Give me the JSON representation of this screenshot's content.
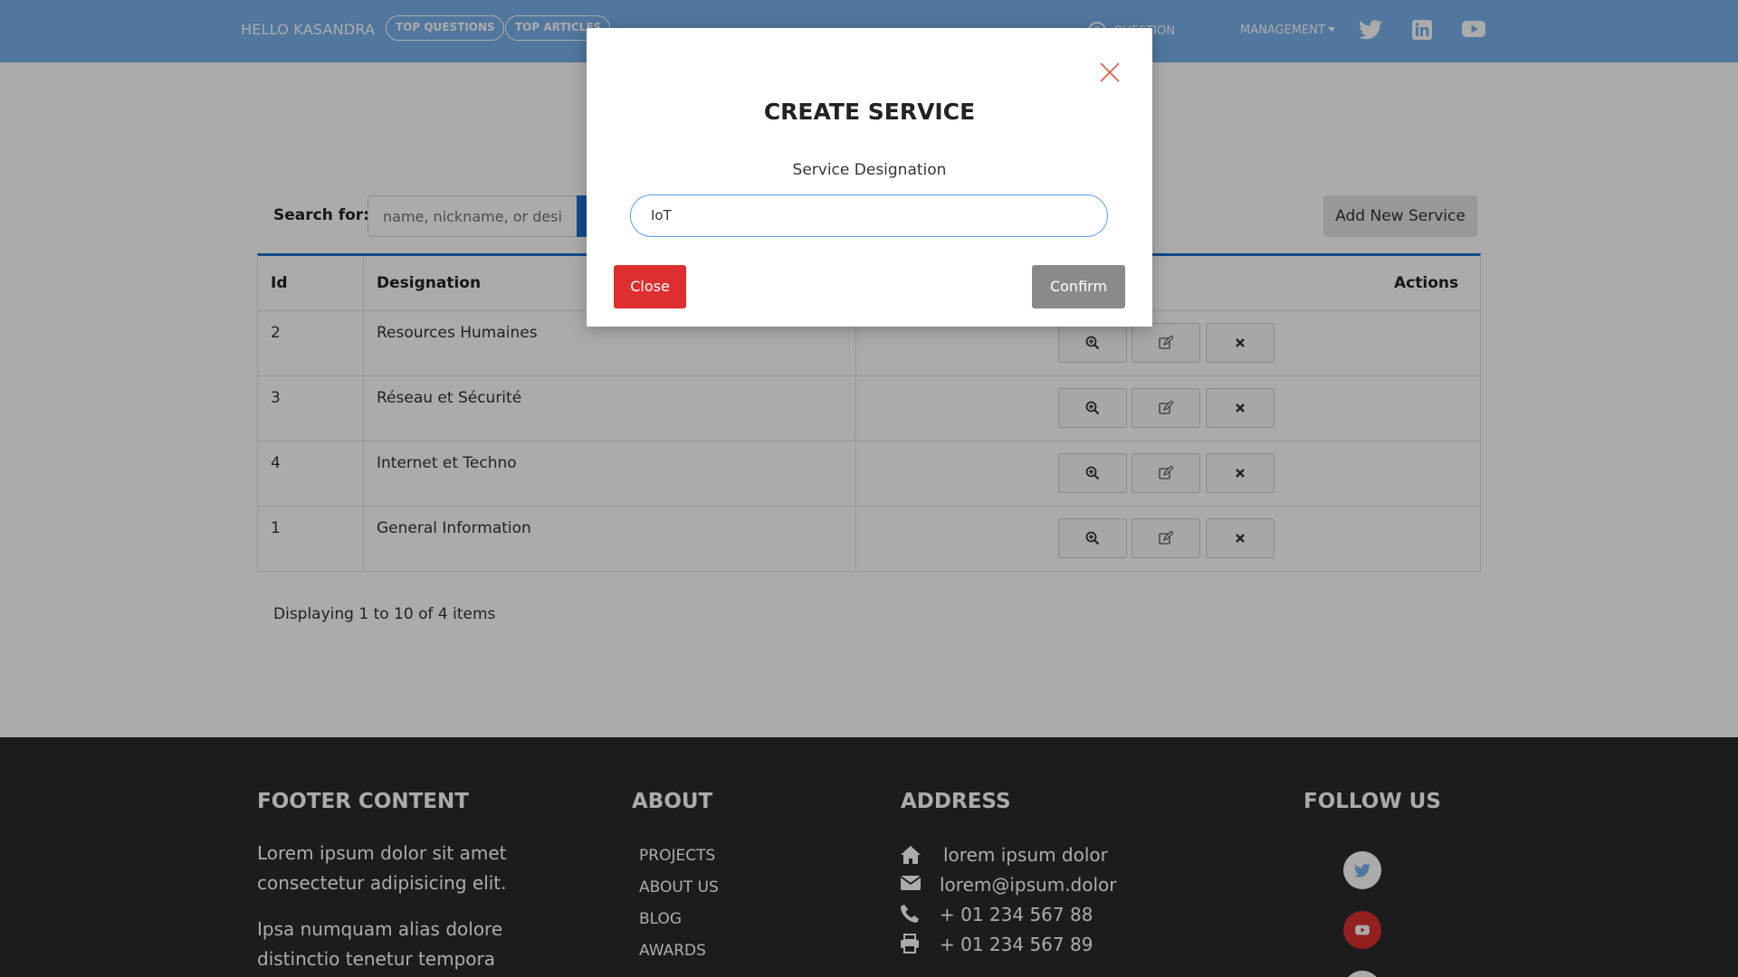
{
  "navbar": {
    "greeting": "HELLO KASANDRA",
    "pills": [
      "TOP QUESTIONS",
      "TOP ARTICLES"
    ],
    "ask_question": "QUESTION",
    "management": "MANAGEMENT",
    "social_icons": [
      "twitter-icon",
      "linkedin-icon",
      "youtube-icon"
    ]
  },
  "search": {
    "label": "Search for:",
    "placeholder": "name, nickname, or designation"
  },
  "add_new_service_label": "Add New Service",
  "table": {
    "headers": {
      "id": "Id",
      "designation": "Designation",
      "actions": "Actions"
    },
    "rows": [
      {
        "id": "2",
        "designation": "Resources Humaines"
      },
      {
        "id": "3",
        "designation": "Réseau et Sécurité"
      },
      {
        "id": "4",
        "designation": "Internet et Techno"
      },
      {
        "id": "1",
        "designation": "General Information"
      }
    ]
  },
  "pagination_text": "Displaying 1 to 10 of 4 items",
  "footer": {
    "content": {
      "heading": "FOOTER CONTENT",
      "para1": "Lorem ipsum dolor sit amet consectetur adipisicing elit.",
      "para2": "Ipsa numquam alias dolore distinctio tenetur tempora"
    },
    "about": {
      "heading": "ABOUT",
      "links": [
        "PROJECTS",
        "ABOUT US",
        "BLOG",
        "AWARDS"
      ]
    },
    "address": {
      "heading": "ADDRESS",
      "home": "lorem ipsum dolor",
      "email": "lorem@ipsum.dolor",
      "phone": "+ 01 234 567 88",
      "fax": "+ 01 234 567 89"
    },
    "follow": {
      "heading": "FOLLOW US"
    }
  },
  "modal": {
    "title": "CREATE SERVICE",
    "field_label": "Service Designation",
    "field_value": "IoT",
    "close_label": "Close",
    "confirm_label": "Confirm"
  },
  "colors": {
    "navbar": "#7ab2ec",
    "primary": "#1b6fd0",
    "danger": "#dd2f2f",
    "footer": "#2b2b2b"
  }
}
